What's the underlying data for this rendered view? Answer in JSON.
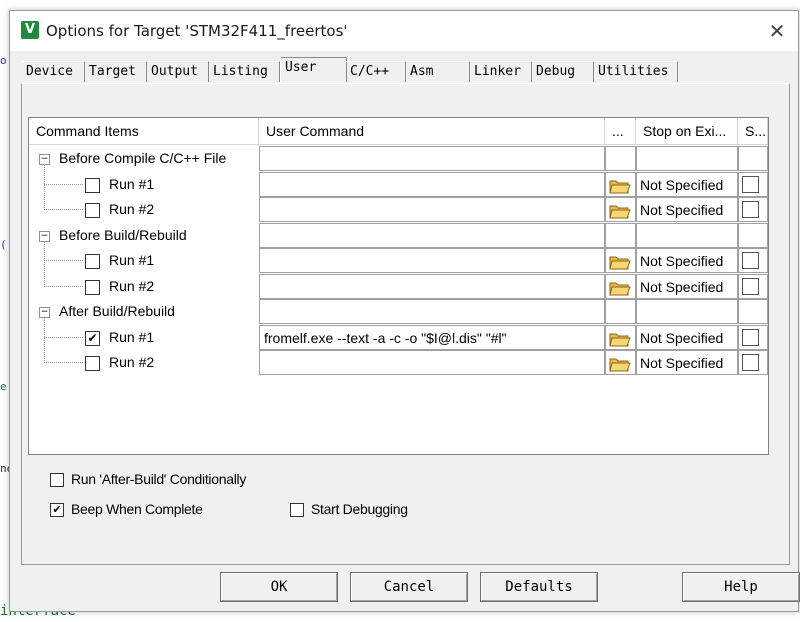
{
  "window": {
    "title": "Options for Target 'STM32F411_freertos'",
    "app_icon": "keil-uv-icon",
    "close_glyph": "✕"
  },
  "background": {
    "bottom_text": "interface",
    "left_fragments": [
      "o:",
      "(",
      "e",
      "ne"
    ]
  },
  "tabs": [
    {
      "label": "Device"
    },
    {
      "label": "Target"
    },
    {
      "label": "Output"
    },
    {
      "label": "Listing"
    },
    {
      "label": "User",
      "active": true
    },
    {
      "label": "C/C++"
    },
    {
      "label": "Asm"
    },
    {
      "label": "Linker"
    },
    {
      "label": "Debug"
    },
    {
      "label": "Utilities"
    }
  ],
  "grid": {
    "headers": {
      "command_items": "Command Items",
      "user_command": "User Command",
      "browse": "...",
      "stop_on_exit": "Stop on Exi...",
      "s": "S..."
    },
    "groups": [
      {
        "label": "Before Compile C/C++ File",
        "expander": "−",
        "rows": [
          {
            "label": "Run #1",
            "checked": false,
            "command": "",
            "stop": "Not Specified",
            "s_checked": false
          },
          {
            "label": "Run #2",
            "checked": false,
            "command": "",
            "stop": "Not Specified",
            "s_checked": false
          }
        ]
      },
      {
        "label": "Before Build/Rebuild",
        "expander": "−",
        "rows": [
          {
            "label": "Run #1",
            "checked": false,
            "command": "",
            "stop": "Not Specified",
            "s_checked": false
          },
          {
            "label": "Run #2",
            "checked": false,
            "command": "",
            "stop": "Not Specified",
            "s_checked": false
          }
        ]
      },
      {
        "label": "After Build/Rebuild",
        "expander": "−",
        "rows": [
          {
            "label": "Run #1",
            "checked": true,
            "command": "fromelf.exe --text -a -c -o \"$I@l.dis\" \"#l\"",
            "stop": "Not Specified",
            "s_checked": false
          },
          {
            "label": "Run #2",
            "checked": false,
            "command": "",
            "stop": "Not Specified",
            "s_checked": false
          }
        ]
      }
    ],
    "check_glyph": "✔",
    "folder_icon": "folder-open-icon"
  },
  "options": {
    "run_after_build": {
      "label": "Run 'After-Build' Conditionally",
      "checked": false
    },
    "beep_when_complete": {
      "label": "Beep When Complete",
      "checked": true
    },
    "start_debugging": {
      "label": "Start Debugging",
      "checked": false
    }
  },
  "buttons": {
    "ok": "OK",
    "cancel": "Cancel",
    "defaults": "Defaults",
    "help": "Help"
  },
  "colors": {
    "dialog_bg": "#f0f0f0",
    "grid_bg": "#ffffff",
    "icon_green": "#1f8a3d",
    "code_green": "#1a7a3c"
  }
}
